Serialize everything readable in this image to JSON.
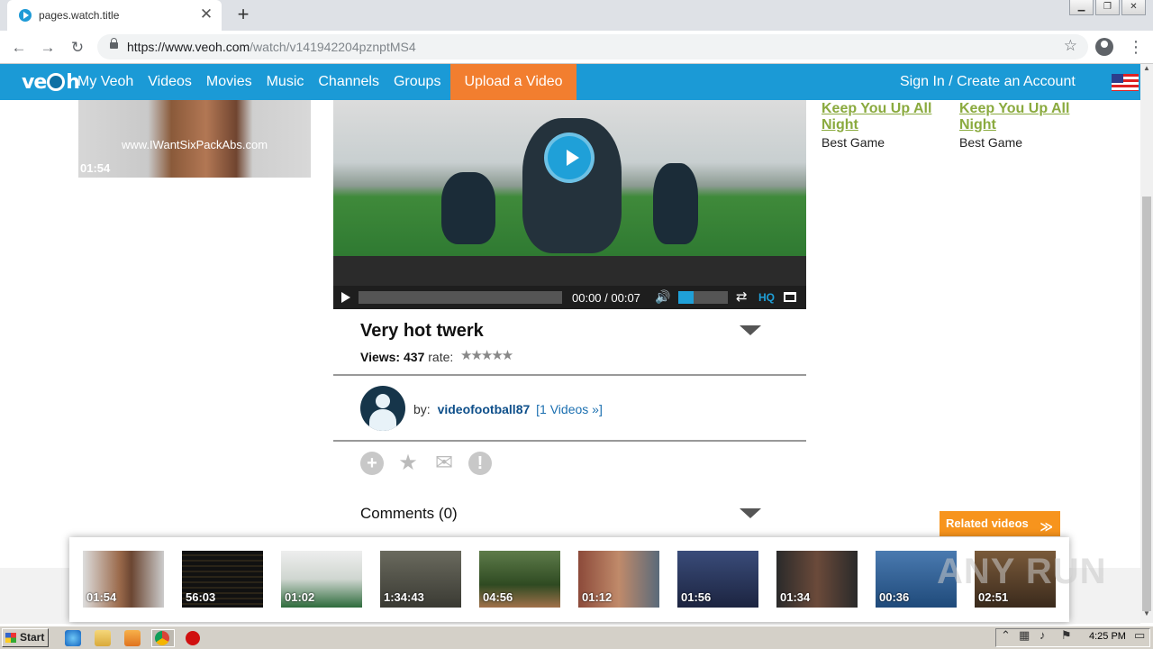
{
  "browser": {
    "tab_title": "pages.watch.title",
    "tab_close": "✕",
    "new_tab": "+",
    "url_host": "https://www.veoh.com",
    "url_path": "/watch/v141942204pznptMS4",
    "star": "☆",
    "back_icon": "←",
    "forward_icon": "→",
    "reload_icon": "↻",
    "menu_icon": "⋮",
    "win_minimize": "▁",
    "win_restore": "❐",
    "win_close": "✕"
  },
  "veoh_nav": {
    "logo_pre": "ve",
    "logo_post": "h",
    "links": [
      "My Veoh",
      "Videos",
      "Movies",
      "Music",
      "Channels",
      "Groups"
    ],
    "upload": "Upload a Video",
    "signin": "Sign In / Create an Account"
  },
  "left_thumb": {
    "watermark": "www.IWantSixPackAbs.com",
    "duration": "01:54"
  },
  "player": {
    "time": "00:00 / 00:07",
    "hq": "HQ",
    "volume_level": 0.3,
    "progress": 0,
    "volume_icon": "🔊",
    "loop_icon": "⇄"
  },
  "video": {
    "title": "Very hot twerk",
    "views_label": "Views:",
    "views": "437",
    "rate_label": "rate:",
    "stars": "★★★★★"
  },
  "author": {
    "by_label": "by:",
    "username": "videofootball87",
    "videos_link": "[1 Videos »]"
  },
  "actions": {
    "add_icon": "+",
    "favorite_icon": "★",
    "email_icon": "✉",
    "flag_icon": "!"
  },
  "comments": {
    "label": "Comments (0)"
  },
  "sidebar": {
    "items": [
      {
        "link_line1": "Keep You Up All",
        "link_line2": "Night",
        "category": "Best Game"
      },
      {
        "link_line1": "Keep You Up All",
        "link_line2": "Night",
        "category": "Best Game"
      }
    ]
  },
  "related": {
    "label": "Related videos",
    "chevron": "≫",
    "items": [
      {
        "duration": "01:54"
      },
      {
        "duration": "56:03"
      },
      {
        "duration": "01:02"
      },
      {
        "duration": "1:34:43"
      },
      {
        "duration": "04:56"
      },
      {
        "duration": "01:12"
      },
      {
        "duration": "01:56"
      },
      {
        "duration": "01:34"
      },
      {
        "duration": "00:36"
      },
      {
        "duration": "02:51"
      }
    ]
  },
  "watermark": "ANY RUN",
  "taskbar": {
    "start": "Start",
    "clock": "4:25 PM"
  },
  "colors": {
    "veoh_blue": "#1b9ad6",
    "upload_orange": "#f27e2f",
    "related_orange": "#f7941d",
    "sidebar_link": "#8aaa3e"
  }
}
